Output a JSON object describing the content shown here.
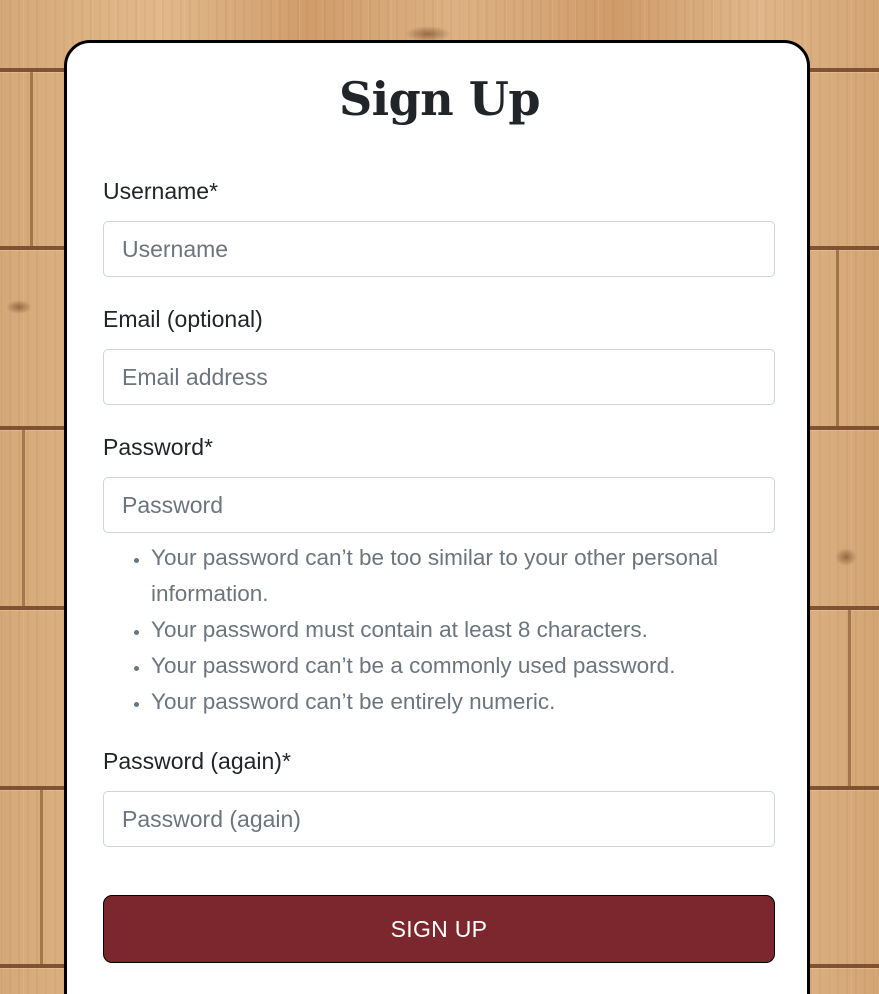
{
  "form": {
    "title": "Sign Up",
    "fields": {
      "username": {
        "label": "Username*",
        "placeholder": "Username",
        "value": ""
      },
      "email": {
        "label": "Email (optional)",
        "placeholder": "Email address",
        "value": ""
      },
      "password": {
        "label": "Password*",
        "placeholder": "Password",
        "value": ""
      },
      "password_again": {
        "label": "Password (again)*",
        "placeholder": "Password (again)",
        "value": ""
      }
    },
    "password_help": [
      "Your password can’t be too similar to your other personal information.",
      "Your password must contain at least 8 characters.",
      "Your password can’t be a commonly used password.",
      "Your password can’t be entirely numeric."
    ],
    "submit_label": "SIGN UP"
  },
  "colors": {
    "button_background": "#7b272d",
    "button_text": "#ffffff",
    "card_border": "#000000",
    "help_text": "#6c757d",
    "background_wood": "#d9ad7e"
  }
}
